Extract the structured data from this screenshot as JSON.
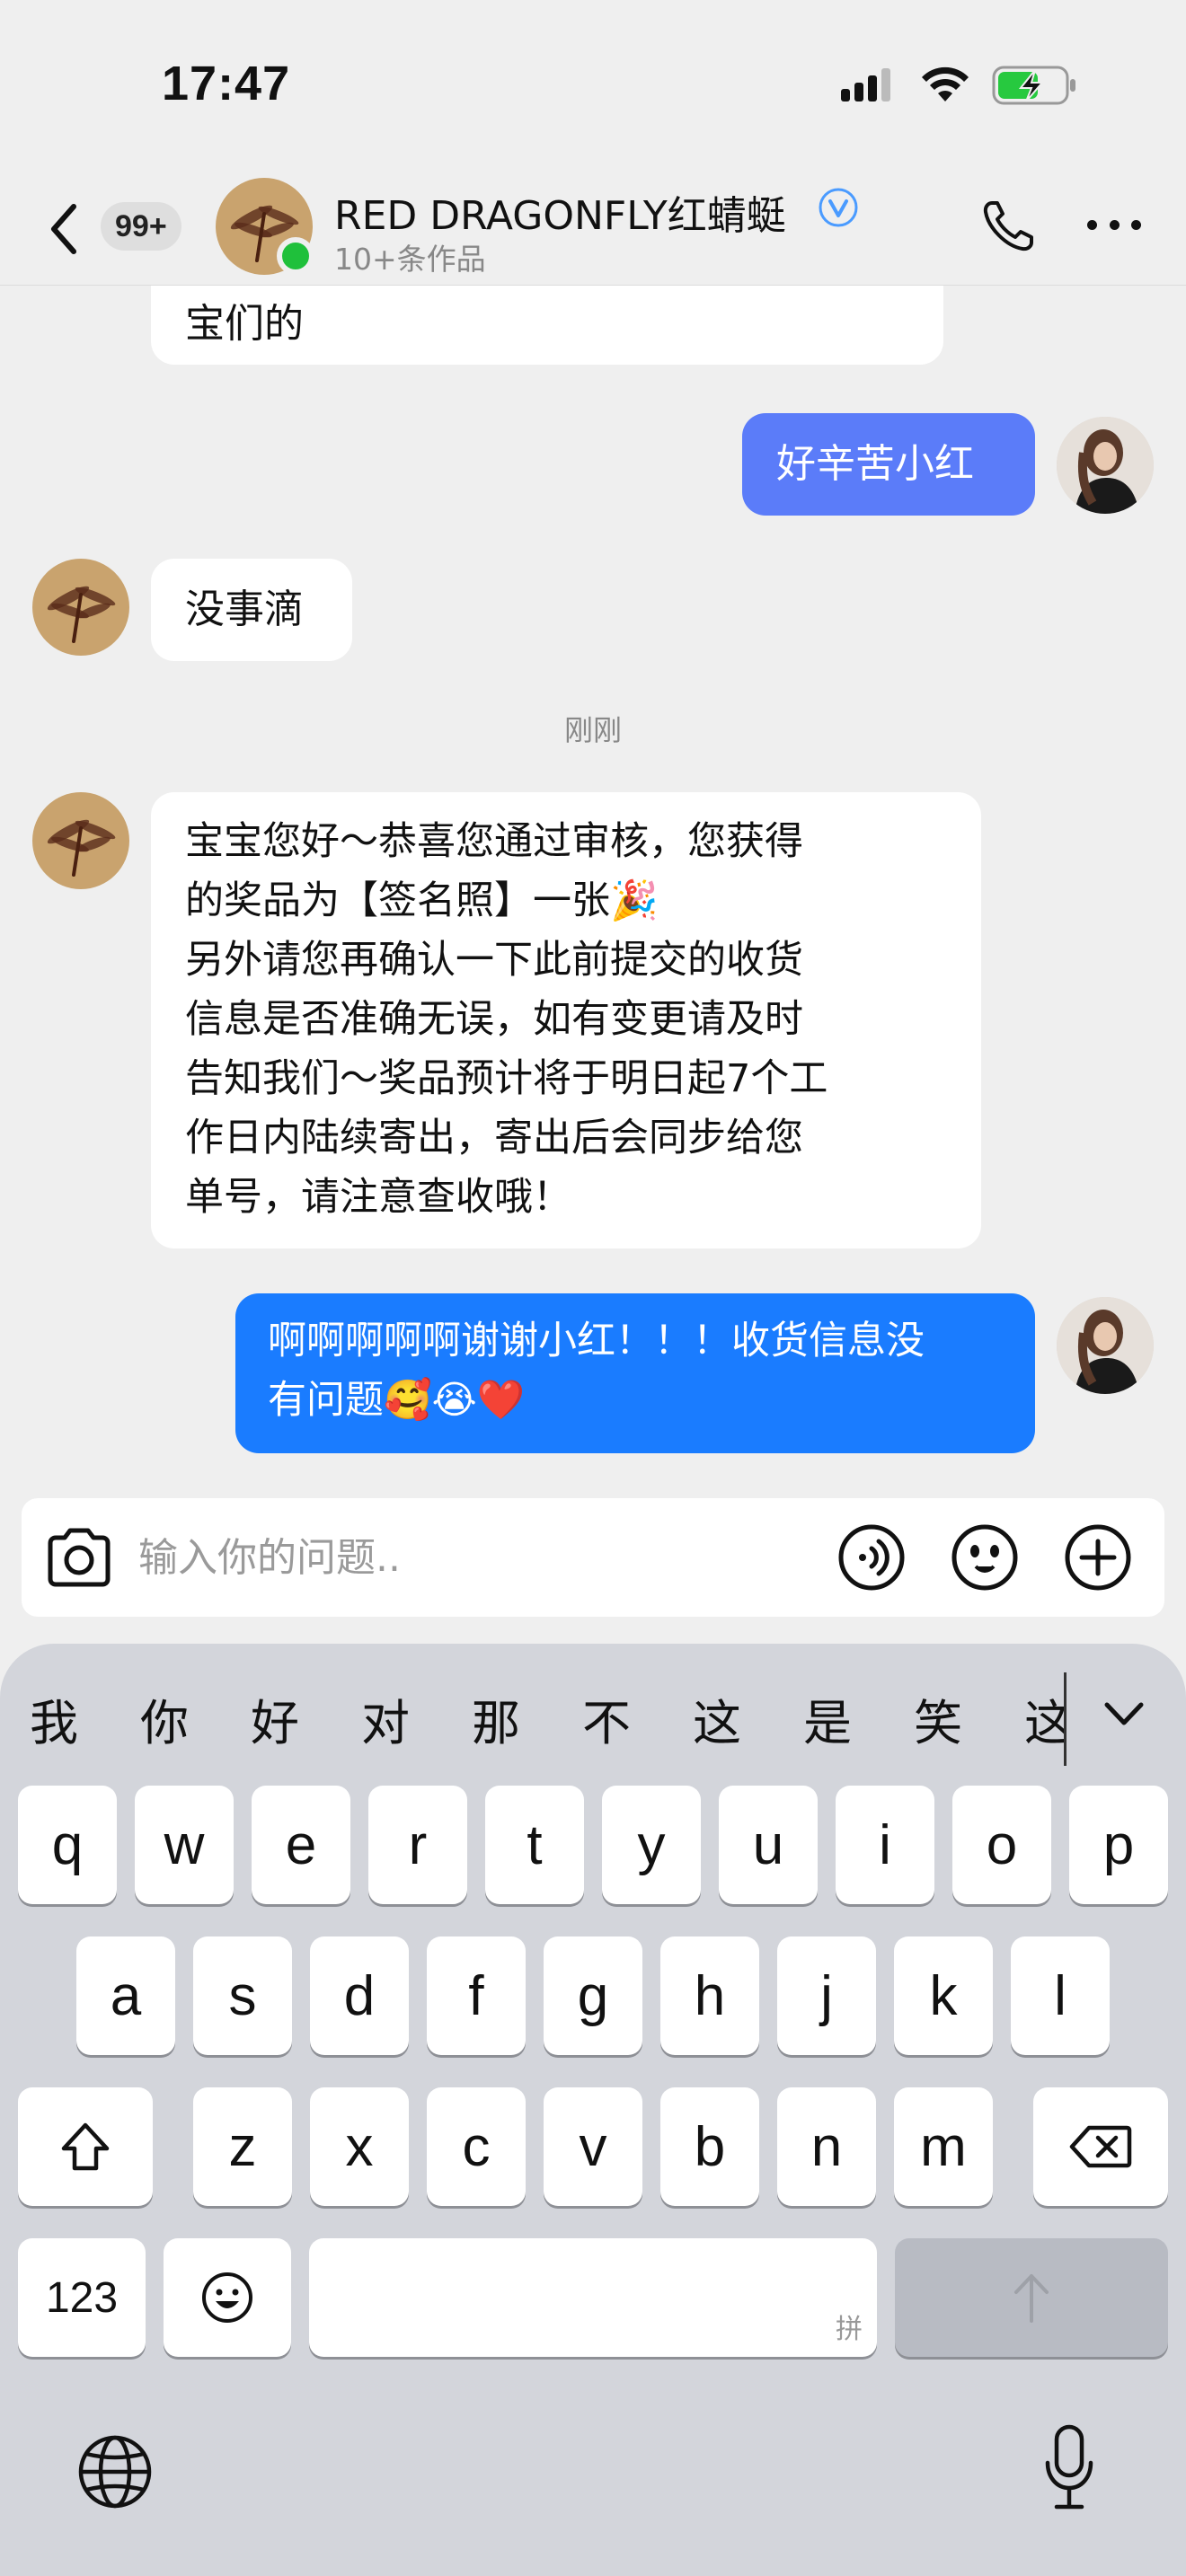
{
  "status": {
    "time": "17:47"
  },
  "header": {
    "unread": "99+",
    "name": "RED DRAGONFLY红蜻蜓",
    "subtitle": "10+条作品"
  },
  "chat": {
    "msg1_tail": "宝们的",
    "msg2": "好辛苦小红",
    "msg3": "没事滴",
    "timestamp": "刚刚",
    "msg4_lines": [
      "宝宝您好～恭喜您通过审核，您获得",
      "的奖品为【签名照】一张🎉",
      "另外请您再确认一下此前提交的收货",
      "信息是否准确无误，如有变更请及时",
      "告知我们～奖品预计将于明日起7个工",
      "作日内陆续寄出，寄出后会同步给您",
      "单号，请注意查收哦！"
    ],
    "msg5_lines": [
      "啊啊啊啊啊谢谢小红！！！收货信息没",
      "有问题🥰😭❤️"
    ]
  },
  "input": {
    "placeholder": "输入你的问题.."
  },
  "keyboard": {
    "candidates": [
      "我",
      "你",
      "好",
      "对",
      "那",
      "不",
      "这",
      "是",
      "笑",
      "这"
    ],
    "row1": [
      "q",
      "w",
      "e",
      "r",
      "t",
      "y",
      "u",
      "i",
      "o",
      "p"
    ],
    "row2": [
      "a",
      "s",
      "d",
      "f",
      "g",
      "h",
      "j",
      "k",
      "l"
    ],
    "row3": [
      "z",
      "x",
      "c",
      "v",
      "b",
      "n",
      "m"
    ],
    "num_label": "123",
    "space_hint": "拼"
  },
  "colors": {
    "outgoing": "#1a7cff",
    "outgoing_light": "#5b7cf9",
    "online": "#1fc03b",
    "verified": "#4a9bff"
  }
}
